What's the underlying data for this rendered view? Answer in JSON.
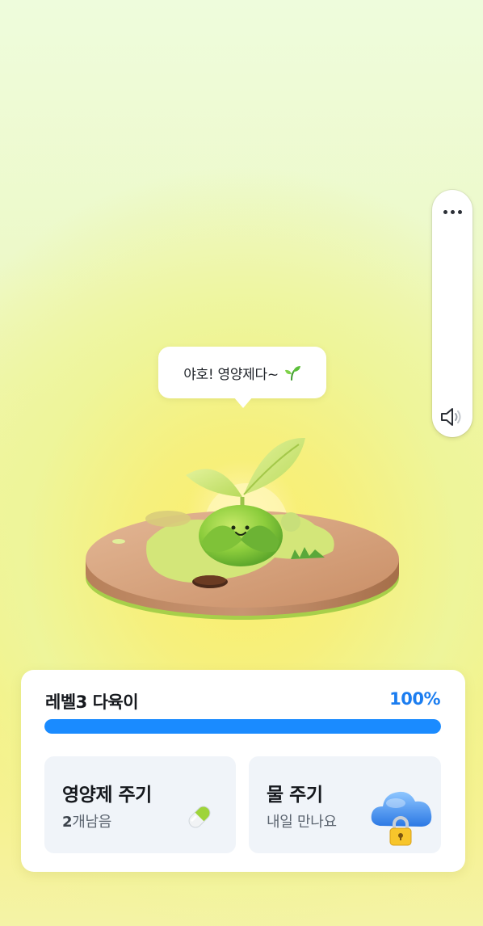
{
  "bubble": {
    "text": "야호! 영양제다~",
    "icon": "sprout-icon"
  },
  "side_panel": {
    "more_icon": "more-dots-icon",
    "sound_icon": "speaker-icon"
  },
  "plant": {
    "level_label": "레벨3 다육이",
    "progress_text": "100%",
    "progress_value": 1.0
  },
  "actions": {
    "nutrient": {
      "title": "영양제 주기",
      "count": "2",
      "count_suffix": "개남음",
      "icon": "pill-icon"
    },
    "water": {
      "title": "물 주기",
      "subtitle": "내일 만나요",
      "icon": "locked-cloud-icon"
    }
  },
  "colors": {
    "accent": "#1a8bff",
    "percent_text": "#1b7df0",
    "card_bg": "#ffffff",
    "action_bg": "#f0f4f9"
  }
}
